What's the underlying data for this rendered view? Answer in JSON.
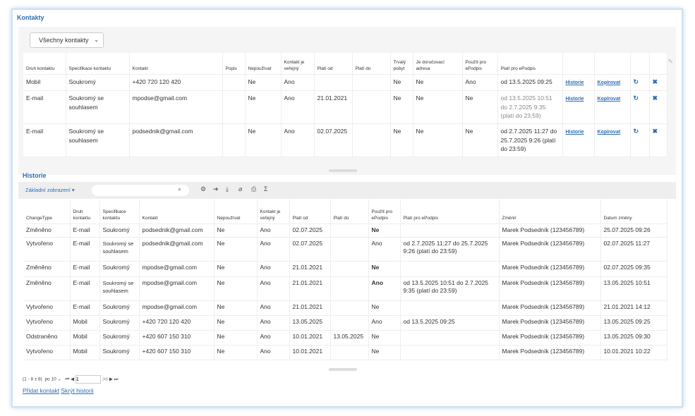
{
  "contacts": {
    "title": "Kontakty",
    "filter": "Všechny kontakty",
    "headers": [
      "Druh kontaktu",
      "Specifikace kontaktu",
      "Kontakt",
      "Popis",
      "Nepoužívat",
      "Kontakt je veřejný",
      "Platí od",
      "Platí do",
      "Trvalý pobyt",
      "Je doručovací adresa",
      "Použít pro ePodpis",
      "Platí pro ePodpis",
      "",
      "",
      "",
      ""
    ],
    "rows": [
      [
        "Mobil",
        "Soukromý",
        "+420 720 120 420",
        "",
        "Ne",
        "Ano",
        "",
        "",
        "Ne",
        "Ne",
        "Ano",
        "od 13.5.2025 09:25"
      ],
      [
        "E-mail",
        "Soukromý se souhlasem",
        "mpodse@gmail.com",
        "",
        "Ne",
        "Ano",
        "21.01.2021",
        "",
        "Ne",
        "Ne",
        "Ne",
        "od 13.5.2025 10:51 do 2.7.2025 9:35 (platí do 23:59)"
      ],
      [
        "E-mail",
        "Soukromý se souhlasem",
        "podsednik@gmail.com",
        "",
        "Ne",
        "Ano",
        "02.07.2025",
        "",
        "Ne",
        "Ne",
        "Ne",
        "od 2.7.2025 11:27 do 25.7.2025 9:26 (platí do 23:59)"
      ]
    ],
    "history_link": "Historie",
    "copy_link": "Kopírovat"
  },
  "history": {
    "title": "Historie",
    "view": "Základní zobrazení ▾",
    "headers": [
      "ChangeType",
      "Druh kontaktu",
      "Specifikace kontaktu",
      "Kontakt",
      "Nepoužívat",
      "Kontakt je veřejný",
      "Platí od",
      "Platí do",
      "Použít pro ePodpis",
      "Platí pro ePodpis",
      "Změnil",
      "Datum změny"
    ],
    "rows": [
      [
        "Změněno",
        "E-mail",
        "Soukromý",
        "podsednik@gmail.com",
        "Ne",
        "Ano",
        "02.07.2025",
        "",
        "Ne",
        "",
        "Marek Podsedník (123456789)",
        "25.07.2025 09:26"
      ],
      [
        "Vytvořeno",
        "E-mail",
        "Soukromý se souhlasem",
        "podsednik@gmail.com",
        "Ne",
        "Ano",
        "02.07.2025",
        "",
        "Ano",
        "od 2.7.2025 11:27 do 25.7.2025 9:26 (platí do 23:59)",
        "Marek Podsedník (123456789)",
        "02.07.2025 11:27"
      ],
      [
        "Změněno",
        "E-mail",
        "Soukromý",
        "mpodse@gmail.com",
        "Ne",
        "Ano",
        "21.01.2021",
        "",
        "Ne",
        "",
        "Marek Podsedník (123456789)",
        "02.07.2025 09:35"
      ],
      [
        "Změněno",
        "E-mail",
        "Soukromý se souhlasem",
        "mpodse@gmail.com",
        "Ne",
        "Ano",
        "21.01.2021",
        "",
        "Ano",
        "od 13.5.2025 10:51 do 2.7.2025 9:35 (platí do 23:59)",
        "Marek Podsedník (123456789)",
        "13.05.2025 10:51"
      ],
      [
        "Vytvořeno",
        "E-mail",
        "Soukromý",
        "mpodse@gmail.com",
        "Ne",
        "Ano",
        "21.01.2021",
        "",
        "Ne",
        "",
        "Marek Podsedník (123456789)",
        "21.01.2021 14:12"
      ],
      [
        "Vytvořeno",
        "Mobil",
        "Soukromý",
        "+420 720 120 420",
        "Ne",
        "Ano",
        "13.05.2025",
        "",
        "Ano",
        "od 13.5.2025 09:25",
        "Marek Podsedník (123456789)",
        "13.05.2025 09:25"
      ],
      [
        "Odstraněno",
        "Mobil",
        "Soukromý",
        "+420 607 150 310",
        "Ne",
        "Ano",
        "10.01.2021",
        "13.05.2025",
        "Ne",
        "",
        "Marek Podsedník (123456789)",
        "13.05.2025 09:30"
      ],
      [
        "Vytvořeno",
        "Mobil",
        "Soukromý",
        "+420 607 150 310",
        "Ne",
        "Ano",
        "10.01.2021",
        "",
        "Ne",
        "",
        "Marek Podsedník (123456789)",
        "10.01.2021 10:22"
      ]
    ],
    "bold_epodpis_rows": [
      0,
      2,
      3
    ]
  },
  "pager": {
    "range": "(1 - 8 z 8)",
    "per_page": "po 10",
    "page": "1",
    "go": "Jdi"
  },
  "links": {
    "add": "Přidat kontakt",
    "hide": "Skrýt historii"
  }
}
